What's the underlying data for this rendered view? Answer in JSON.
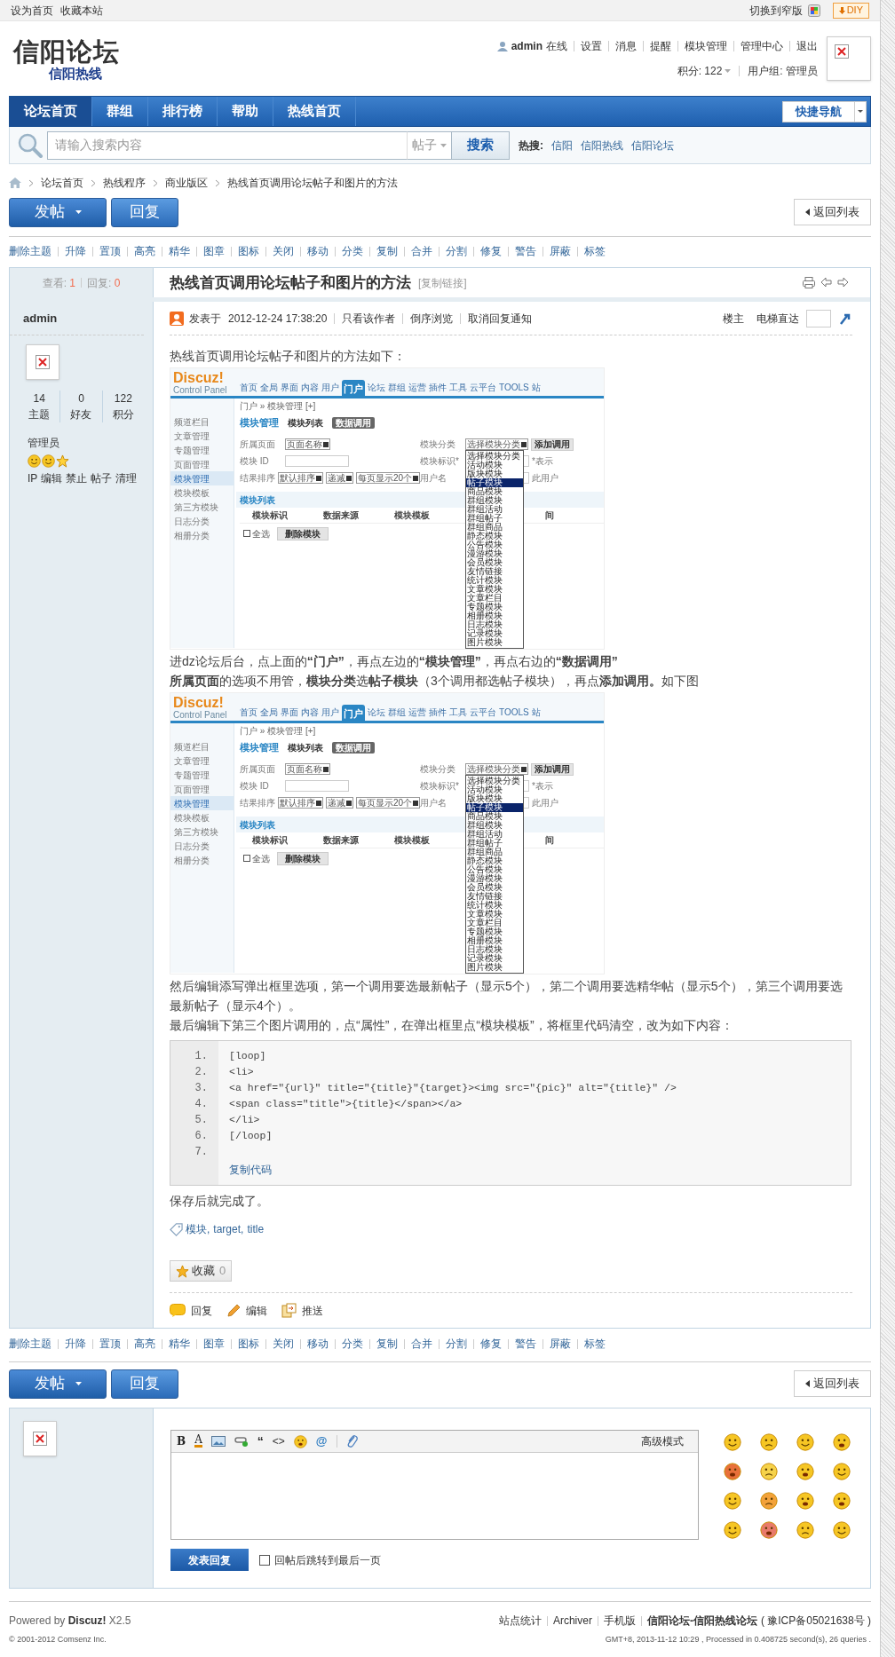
{
  "topbar": {
    "links": [
      "设为首页",
      "收藏本站"
    ],
    "switch_width": "切换到窄版",
    "diy": "DIY"
  },
  "header": {
    "logo_title": "信阳论坛",
    "logo_sub": "信阳热线",
    "user": "admin",
    "user_status": "在线",
    "user_links": [
      "设置",
      "消息",
      "提醒",
      "模块管理",
      "管理中心",
      "退出"
    ],
    "credits": "积分: 122",
    "usergroup": "用户组: 管理员"
  },
  "nav": {
    "items": [
      {
        "label": "论坛首页",
        "selected": true
      },
      {
        "label": "群组",
        "selected": false
      },
      {
        "label": "排行榜",
        "selected": false
      },
      {
        "label": "帮助",
        "selected": false
      },
      {
        "label": "热线首页",
        "selected": false
      }
    ],
    "quick_nav": "快捷导航"
  },
  "search": {
    "placeholder": "请输入搜索内容",
    "scope": "帖子",
    "button": "搜索",
    "hot_label": "热搜:",
    "hot": [
      "信阳",
      "信阳热线",
      "信阳论坛"
    ]
  },
  "breadcrumb": [
    "论坛首页",
    "热线程序",
    "商业版区",
    "热线首页调用论坛帖子和图片的方法"
  ],
  "actions_top": {
    "post": "发帖",
    "reply": "回复",
    "back": "返回列表"
  },
  "mod_links_top": [
    "删除主题",
    "升降",
    "置顶",
    "高亮",
    "精华",
    "图章",
    "图标",
    "关闭",
    "移动",
    "分类",
    "复制",
    "合并",
    "分割",
    "修复",
    "警告",
    "屏蔽",
    "标签"
  ],
  "thread": {
    "views_label": "查看:",
    "views": "1",
    "replies_label": "回复:",
    "replies": "0",
    "title": "热线首页调用论坛帖子和图片的方法",
    "copy_link": "[复制链接]"
  },
  "author": {
    "name": "admin",
    "stats": [
      {
        "value": "14",
        "label": "主题"
      },
      {
        "value": "0",
        "label": "好友"
      },
      {
        "value": "122",
        "label": "积分"
      }
    ],
    "group": "管理员",
    "admin_links": [
      "IP",
      "编辑",
      "禁止",
      "帖子",
      "清理"
    ]
  },
  "post": {
    "posted_label": "发表于",
    "time": "2012-12-24 17:38:20",
    "links": [
      "只看该作者",
      "倒序浏览",
      "取消回复通知"
    ],
    "floor": "楼主",
    "jump_label": "电梯直达",
    "body": [
      {
        "kind": "text",
        "lines": [
          "热线首页调用论坛帖子和图片的方法如下："
        ]
      },
      {
        "kind": "screenshot",
        "logo": "Discuz!",
        "logo_sub": "Control Panel",
        "tabs": [
          {
            "label": "首页",
            "selected": false
          },
          {
            "label": "全局",
            "selected": false
          },
          {
            "label": "界面",
            "selected": false
          },
          {
            "label": "内容",
            "selected": false
          },
          {
            "label": "用户",
            "selected": false
          },
          {
            "label": "门户",
            "selected": true
          },
          {
            "label": "论坛",
            "selected": false
          },
          {
            "label": "群组",
            "selected": false
          },
          {
            "label": "运营",
            "selected": false
          },
          {
            "label": "插件",
            "selected": false
          },
          {
            "label": "工具",
            "selected": false
          },
          {
            "label": "云平台",
            "selected": false
          },
          {
            "label": "TOOLS",
            "selected": false
          },
          {
            "label": "站",
            "selected": false
          }
        ],
        "breadcrumb": "门户 » 模块管理 [+]",
        "menu": [
          {
            "label": "频道栏目",
            "selected": false
          },
          {
            "label": "文章管理",
            "selected": false
          },
          {
            "label": "专题管理",
            "selected": false
          },
          {
            "label": "页面管理",
            "selected": false
          },
          {
            "label": "模块管理",
            "selected": true
          },
          {
            "label": "模块模板",
            "selected": false
          },
          {
            "label": "第三方模块",
            "selected": false
          },
          {
            "label": "日志分类",
            "selected": false
          },
          {
            "label": "相册分类",
            "selected": false
          }
        ],
        "heading": "模块管理",
        "subtabs": [
          {
            "label": "模块列表",
            "selected": false
          },
          {
            "label": "数据调用",
            "selected": true
          }
        ],
        "form": [
          [
            {
              "label": "所属页面",
              "kind": "select",
              "values": [
                "页面名称"
              ]
            },
            {
              "label": "模块分类",
              "kind": "select",
              "values": [
                "选择模块分类"
              ],
              "button": "添加调用"
            }
          ],
          [
            {
              "label": "模块 ID",
              "kind": "input"
            },
            {
              "label": "模块标识*",
              "kind": "input",
              "note": "*表示"
            }
          ],
          [
            {
              "label": "结果排序",
              "kind": "select",
              "values": [
                "默认排序",
                "递减",
                "每页显示20个"
              ]
            },
            {
              "label": "用户名",
              "kind": "input",
              "note": "此用户"
            }
          ]
        ],
        "list_title": "模块列表",
        "columns": [
          "模块标识",
          "数据来源",
          "模块模板",
          "间"
        ],
        "select_all": {
          "label": "全选",
          "checked": false
        },
        "delete": "删除模块",
        "dropdown": [
          {
            "label": "选择模块分类",
            "selected": false
          },
          {
            "label": "活动模块",
            "selected": false
          },
          {
            "label": "版块模块",
            "selected": false
          },
          {
            "label": "帖子模块",
            "selected": true
          },
          {
            "label": "商品模块",
            "selected": false
          },
          {
            "label": "群组模块",
            "selected": false
          },
          {
            "label": "群组活动",
            "selected": false
          },
          {
            "label": "群组帖子",
            "selected": false
          },
          {
            "label": "群组商品",
            "selected": false
          },
          {
            "label": "静态模块",
            "selected": false
          },
          {
            "label": "公告模块",
            "selected": false
          },
          {
            "label": "漫游模块",
            "selected": false
          },
          {
            "label": "会员模块",
            "selected": false
          },
          {
            "label": "友情链接",
            "selected": false
          },
          {
            "label": "统计模块",
            "selected": false
          },
          {
            "label": "文章模块",
            "selected": false
          },
          {
            "label": "文章栏目",
            "selected": false
          },
          {
            "label": "专题模块",
            "selected": false
          },
          {
            "label": "相册模块",
            "selected": false
          },
          {
            "label": "日志模块",
            "selected": false
          },
          {
            "label": "记录模块",
            "selected": false
          },
          {
            "label": "图片模块",
            "selected": false
          }
        ]
      },
      {
        "kind": "text",
        "lines": [
          "进dz论坛后台，点上面的**“门户”**，再点左边的**“模块管理”**，再点右边的**“数据调用”**",
          "**所属页面**的选项不用管，**模块分类**选**帖子模块**（3个调用都选帖子模块），再点**添加调用。**如下图"
        ]
      },
      {
        "kind": "screenshot",
        "logo": "Discuz!",
        "logo_sub": "Control Panel",
        "tabs": [
          {
            "label": "首页",
            "selected": false
          },
          {
            "label": "全局",
            "selected": false
          },
          {
            "label": "界面",
            "selected": false
          },
          {
            "label": "内容",
            "selected": false
          },
          {
            "label": "用户",
            "selected": false
          },
          {
            "label": "门户",
            "selected": true
          },
          {
            "label": "论坛",
            "selected": false
          },
          {
            "label": "群组",
            "selected": false
          },
          {
            "label": "运营",
            "selected": false
          },
          {
            "label": "插件",
            "selected": false
          },
          {
            "label": "工具",
            "selected": false
          },
          {
            "label": "云平台",
            "selected": false
          },
          {
            "label": "TOOLS",
            "selected": false
          },
          {
            "label": "站",
            "selected": false
          }
        ],
        "breadcrumb": "门户 » 模块管理 [+]",
        "menu": [
          {
            "label": "频道栏目",
            "selected": false
          },
          {
            "label": "文章管理",
            "selected": false
          },
          {
            "label": "专题管理",
            "selected": false
          },
          {
            "label": "页面管理",
            "selected": false
          },
          {
            "label": "模块管理",
            "selected": true
          },
          {
            "label": "模块模板",
            "selected": false
          },
          {
            "label": "第三方模块",
            "selected": false
          },
          {
            "label": "日志分类",
            "selected": false
          },
          {
            "label": "相册分类",
            "selected": false
          }
        ],
        "heading": "模块管理",
        "subtabs": [
          {
            "label": "模块列表",
            "selected": false
          },
          {
            "label": "数据调用",
            "selected": true
          }
        ],
        "form": [
          [
            {
              "label": "所属页面",
              "kind": "select",
              "values": [
                "页面名称"
              ]
            },
            {
              "label": "模块分类",
              "kind": "select",
              "values": [
                "选择模块分类"
              ],
              "button": "添加调用"
            }
          ],
          [
            {
              "label": "模块 ID",
              "kind": "input"
            },
            {
              "label": "模块标识*",
              "kind": "input",
              "note": "*表示"
            }
          ],
          [
            {
              "label": "结果排序",
              "kind": "select",
              "values": [
                "默认排序",
                "递减",
                "每页显示20个"
              ]
            },
            {
              "label": "用户名",
              "kind": "input",
              "note": "此用户"
            }
          ]
        ],
        "list_title": "模块列表",
        "columns": [
          "模块标识",
          "数据来源",
          "模块模板",
          "间"
        ],
        "select_all": {
          "label": "全选",
          "checked": false
        },
        "delete": "删除模块",
        "dropdown": [
          {
            "label": "选择模块分类",
            "selected": false
          },
          {
            "label": "活动模块",
            "selected": false
          },
          {
            "label": "版块模块",
            "selected": false
          },
          {
            "label": "帖子模块",
            "selected": true
          },
          {
            "label": "商品模块",
            "selected": false
          },
          {
            "label": "群组模块",
            "selected": false
          },
          {
            "label": "群组活动",
            "selected": false
          },
          {
            "label": "群组帖子",
            "selected": false
          },
          {
            "label": "群组商品",
            "selected": false
          },
          {
            "label": "静态模块",
            "selected": false
          },
          {
            "label": "公告模块",
            "selected": false
          },
          {
            "label": "漫游模块",
            "selected": false
          },
          {
            "label": "会员模块",
            "selected": false
          },
          {
            "label": "友情链接",
            "selected": false
          },
          {
            "label": "统计模块",
            "selected": false
          },
          {
            "label": "文章模块",
            "selected": false
          },
          {
            "label": "文章栏目",
            "selected": false
          },
          {
            "label": "专题模块",
            "selected": false
          },
          {
            "label": "相册模块",
            "selected": false
          },
          {
            "label": "日志模块",
            "selected": false
          },
          {
            "label": "记录模块",
            "selected": false
          },
          {
            "label": "图片模块",
            "selected": false
          }
        ]
      },
      {
        "kind": "text",
        "lines": [
          "然后编辑添写弹出框里选项，第一个调用要选最新帖子（显示5个），第二个调用要选精华帖（显示5个），第三个调用要选最新帖子（显示4个）。",
          "最后编辑下第三个图片调用的，点“属性”，在弹出框里点“模块模板”，将框里代码清空，改为如下内容："
        ]
      },
      {
        "kind": "code",
        "lines": [
          {
            "n": "1.",
            "code": "[loop]"
          },
          {
            "n": "2.",
            "code": "<li>"
          },
          {
            "n": "3.",
            "code": "<a href=\"{url}\" title=\"{title}\"{target}><img src=\"{pic}\" alt=\"{title}\" />"
          },
          {
            "n": "4.",
            "code": "<span class=\"title\">{title}</span></a>"
          },
          {
            "n": "5.",
            "code": "</li>"
          },
          {
            "n": "6.",
            "code": "[/loop]"
          },
          {
            "n": "7."
          }
        ],
        "copy": "复制代码"
      },
      {
        "kind": "text",
        "lines": [
          "保存后就完成了。"
        ]
      }
    ],
    "tags": [
      "模块",
      "target",
      "title"
    ],
    "tag_separator": ",",
    "favorite": {
      "label": "收藏",
      "count": "0"
    },
    "actions": [
      "回复",
      "编辑",
      "推送"
    ]
  },
  "mod_links_bottom": [
    "删除主题",
    "升降",
    "置顶",
    "高亮",
    "精华",
    "图章",
    "图标",
    "关闭",
    "移动",
    "分类",
    "复制",
    "合并",
    "分割",
    "修复",
    "警告",
    "屏蔽",
    "标签"
  ],
  "actions_bottom": {
    "post": "发帖",
    "reply": "回复",
    "back": "返回列表"
  },
  "reply": {
    "toolbar": [
      {
        "kind": "bold",
        "label": "B"
      },
      {
        "kind": "color",
        "label": "A"
      },
      {
        "kind": "image"
      },
      {
        "kind": "link"
      },
      {
        "kind": "quote",
        "label": "“"
      },
      {
        "kind": "code",
        "label": "<>"
      },
      {
        "kind": "smiley"
      },
      {
        "kind": "at",
        "label": "@"
      },
      {
        "kind": "attach"
      }
    ],
    "advanced": "高级模式",
    "submit": "发表回复",
    "checkbox": {
      "label": "回帖后跳转到最后一页",
      "checked": false
    }
  },
  "footer": {
    "powered": "Powered by **Discuz!** X2.5",
    "copyright": "© 2001-2012 Comsenz Inc.",
    "links": [
      "站点统计",
      "Archiver",
      "手机版"
    ],
    "site": "信阳论坛-信阳热线论坛",
    "icp": "( 豫ICP备05021638号 )",
    "stats": "GMT+8, 2013-11-12 10:29 , Processed in 0.408725 second(s), 26 queries ."
  }
}
